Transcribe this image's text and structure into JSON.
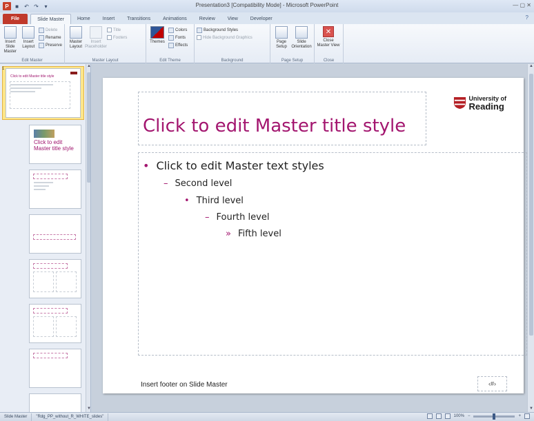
{
  "window": {
    "title": "Presentation3 [Compatibility Mode] - Microsoft PowerPoint",
    "app_icon": "P",
    "controls": "— ▢ ✕"
  },
  "tabs": [
    {
      "label": "File"
    },
    {
      "label": "Slide Master"
    },
    {
      "label": "Home"
    },
    {
      "label": "Insert"
    },
    {
      "label": "Transitions"
    },
    {
      "label": "Animations"
    },
    {
      "label": "Review"
    },
    {
      "label": "View"
    },
    {
      "label": "Developer"
    }
  ],
  "ribbon": {
    "edit_master": {
      "label": "Edit Master",
      "insert_slide_master": "Insert Slide Master",
      "insert_layout": "Insert Layout",
      "delete": "Delete",
      "rename": "Rename",
      "preserve": "Preserve"
    },
    "master_layout": {
      "label": "Master Layout",
      "master_layout_btn": "Master Layout",
      "insert_placeholder": "Insert Placeholder",
      "title": "Title",
      "footers": "Footers"
    },
    "edit_theme": {
      "label": "Edit Theme",
      "themes": "Themes",
      "colors": "Colors",
      "fonts": "Fonts",
      "effects": "Effects"
    },
    "background": {
      "label": "Background",
      "background_styles": "Background Styles",
      "hide_background": "Hide Background Graphics"
    },
    "page_setup": {
      "label": "Page Setup",
      "page_setup_btn": "Page Setup",
      "slide_orientation": "Slide Orientation"
    },
    "close": {
      "label": "Close",
      "close_master_view": "Close Master View"
    }
  },
  "thumbnails": {
    "master_num": "1",
    "master_title": "Click to edit Master title style",
    "layout_title": "Click to edit Master title style"
  },
  "slide": {
    "title": "Click to edit Master title style",
    "levels": [
      "Click to edit Master text styles",
      "Second level",
      "Third level",
      "Fourth level",
      "Fifth level"
    ],
    "bullets": [
      "•",
      "–",
      "•",
      "–",
      "»"
    ],
    "footer": "Insert footer on Slide Master",
    "slide_number": "‹#›",
    "logo_line1": "University of",
    "logo_line2": "Reading"
  },
  "status": {
    "view": "Slide Master",
    "theme": "\"Rdg_PP_without_R_WHITE_slides\"",
    "zoom": "100%"
  },
  "colors": {
    "accent": "#a3166f",
    "file_tab": "#c0392b"
  }
}
